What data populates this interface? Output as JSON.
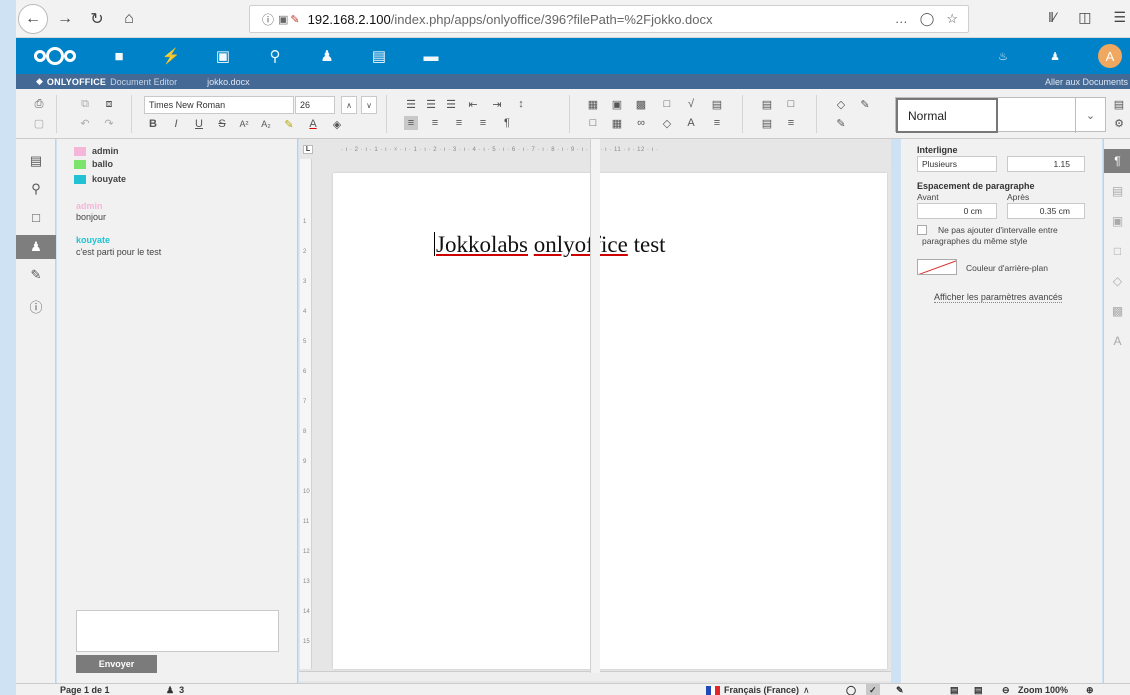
{
  "browser": {
    "url_info_icon": "info-icon",
    "url_host": "192.168.2.100",
    "url_path": "/index.php/apps/onlyoffice/396?filePath=%2Fjokko.docx",
    "url_menu": "…",
    "back": "←",
    "forward": "→",
    "reload": "↻",
    "home": "⌂"
  },
  "nextcloud": {
    "avatar_letter": "A"
  },
  "onlyoffice": {
    "brand": "ONLYOFFICE",
    "subtitle": "Document Editor",
    "filename": "jokko.docx",
    "goto_documents": "Aller aux Documents"
  },
  "toolbar": {
    "font_name": "Times New Roman",
    "font_size": "26",
    "style_name": "Normal",
    "bold": "B",
    "italic": "I",
    "underline": "U",
    "strike": "S",
    "superscript": "A²",
    "subscript": "A₂"
  },
  "chat": {
    "users": [
      {
        "name": "admin",
        "color": "#f4b6d9"
      },
      {
        "name": "ballo",
        "color": "#7ee36b"
      },
      {
        "name": "kouyate",
        "color": "#21c3d2"
      }
    ],
    "messages": [
      {
        "author": "admin",
        "color": "#f4b6d9",
        "text": "bonjour"
      },
      {
        "author": "kouyate",
        "color": "#21c3d2",
        "text": "c'est parti pour le test"
      }
    ],
    "send_label": "Envoyer"
  },
  "document": {
    "words": [
      "Jokkolabs",
      "onlyoffice",
      "test"
    ]
  },
  "settings": {
    "line_spacing_label": "Interligne",
    "line_spacing_mode": "Plusieurs",
    "line_spacing_value": "1.15",
    "para_spacing_label": "Espacement de paragraphe",
    "before_label": "Avant",
    "after_label": "Après",
    "before_value": "0 cm",
    "after_value": "0.35 cm",
    "no_interval_line1": "Ne pas ajouter d'intervalle entre",
    "no_interval_line2": "paragraphes du même style",
    "bg_color_label": "Couleur d'arrière-plan",
    "advanced_link": "Afficher les paramètres avancés"
  },
  "statusbar": {
    "page": "Page 1 de 1",
    "users_count": "3",
    "language": "Français (France)",
    "zoom": "Zoom 100%"
  }
}
